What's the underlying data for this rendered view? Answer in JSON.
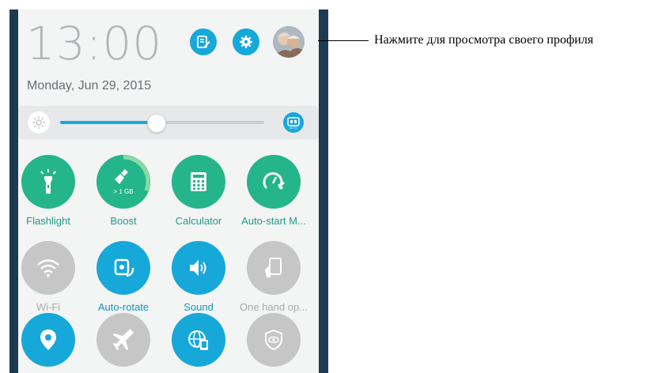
{
  "status": {
    "time": "13:00",
    "date": "Monday, Jun 29, 2015"
  },
  "header": {
    "icons": [
      "note-edit-icon",
      "settings-gear-icon",
      "profile-avatar"
    ]
  },
  "brightness": {
    "level_percent": 47,
    "auto_label": "AUTO"
  },
  "tiles": [
    {
      "label": "Flashlight",
      "state": "on",
      "icon": "flashlight-icon"
    },
    {
      "label": "Boost",
      "state": "on",
      "icon": "boost-broom-icon",
      "sub": "> 1 GB"
    },
    {
      "label": "Calculator",
      "state": "on",
      "icon": "calculator-icon"
    },
    {
      "label": "Auto-start M...",
      "state": "on",
      "icon": "auto-start-icon"
    },
    {
      "label": "Wi-Fi",
      "state": "off",
      "icon": "wifi-icon"
    },
    {
      "label": "Auto-rotate",
      "state": "active",
      "icon": "auto-rotate-icon"
    },
    {
      "label": "Sound",
      "state": "active",
      "icon": "sound-icon"
    },
    {
      "label": "One hand op...",
      "state": "off",
      "icon": "one-hand-icon"
    },
    {
      "label": "",
      "state": "active",
      "icon": "location-pin-icon"
    },
    {
      "label": "",
      "state": "off",
      "icon": "airplane-icon"
    },
    {
      "label": "",
      "state": "active",
      "icon": "globe-device-icon"
    },
    {
      "label": "",
      "state": "off",
      "icon": "shield-eye-icon"
    }
  ],
  "callout": {
    "text": "Нажмите для просмотра своего профиля"
  },
  "colors": {
    "accent_blue": "#16a8d9",
    "accent_green": "#24b58a",
    "inactive_grey": "#c6c6c6"
  }
}
